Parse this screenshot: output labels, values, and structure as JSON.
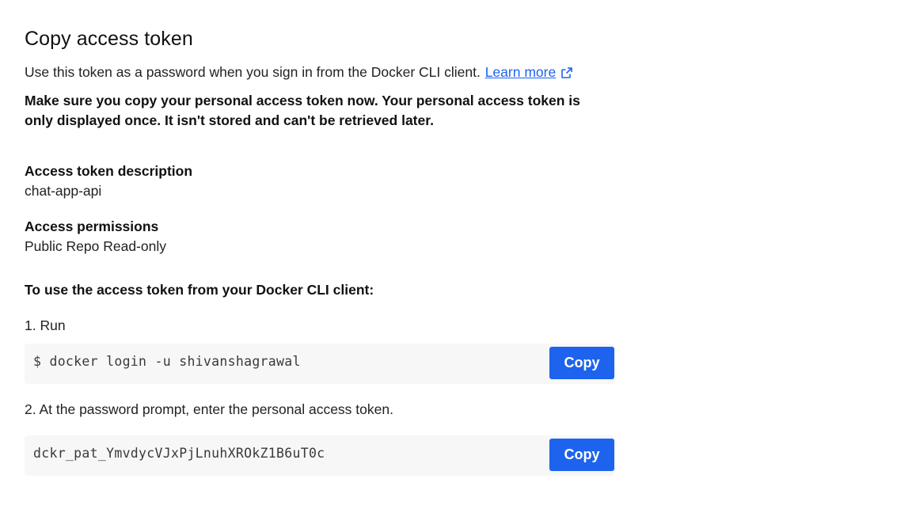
{
  "heading": "Copy access token",
  "intro": {
    "text": "Use this token as a password when you sign in from the Docker CLI client.",
    "link_label": "Learn more"
  },
  "warning": "Make sure you copy your personal access token now. Your personal access token is only displayed once. It isn't stored and can't be retrieved later.",
  "description": {
    "label": "Access token description",
    "value": "chat-app-api"
  },
  "permissions": {
    "label": "Access permissions",
    "value": "Public Repo Read-only"
  },
  "usage_heading": "To use the access token from your Docker CLI client:",
  "steps": [
    {
      "text": "1. Run",
      "code": "$ docker login -u shivanshagrawal",
      "button_label": "Copy"
    },
    {
      "text": "2. At the password prompt, enter the personal access token.",
      "code": "dckr_pat_YmvdycVJxPjLnuhXROkZ1B6uT0c",
      "button_label": "Copy"
    }
  ],
  "colors": {
    "accent": "#1d63ed",
    "code_background": "#f7f7f7"
  },
  "icons": {
    "external_link": "external-link-icon"
  }
}
